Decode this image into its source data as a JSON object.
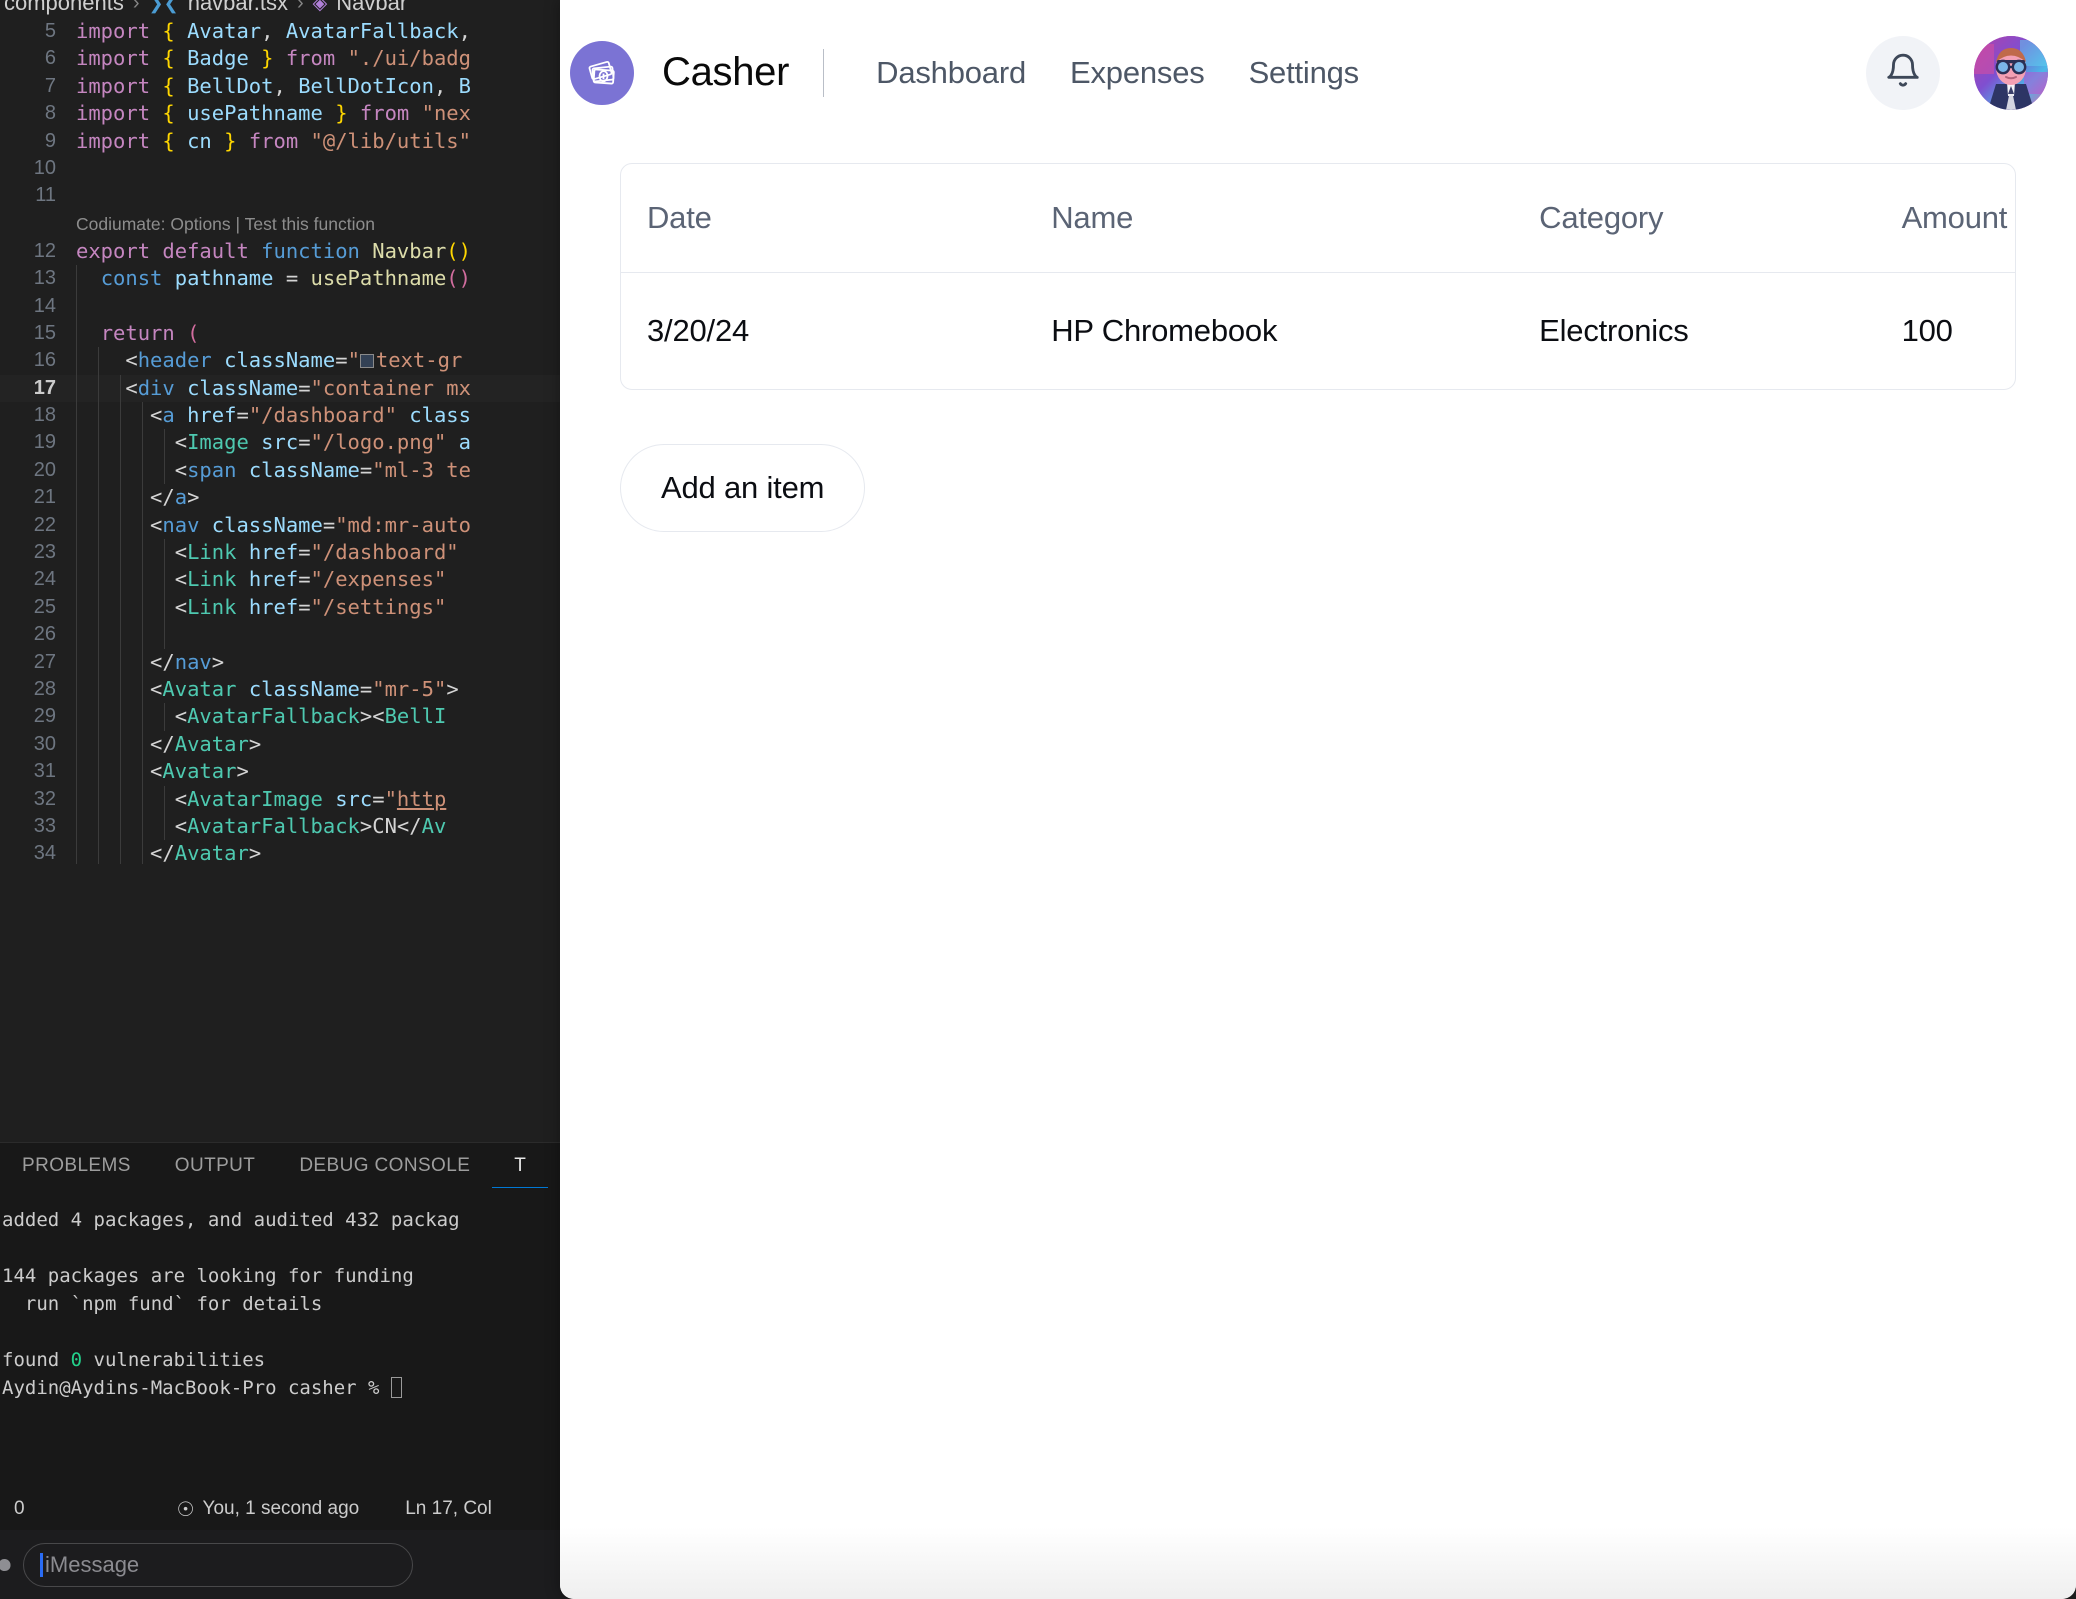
{
  "editor": {
    "breadcrumb": {
      "folder": "components",
      "file": "navbar.tsx",
      "symbol": "Navbar",
      "sep": "›"
    },
    "codiumate_hint": "Codiumate: Options | Test this function",
    "lines": [
      {
        "n": "5",
        "tokens": [
          [
            "t-kw",
            "import "
          ],
          [
            "t-br",
            "{ "
          ],
          [
            "t-var",
            "Avatar"
          ],
          [
            "t-plain",
            ", "
          ],
          [
            "t-var",
            "AvatarFallback"
          ],
          [
            "t-plain",
            ","
          ]
        ]
      },
      {
        "n": "6",
        "tokens": [
          [
            "t-kw",
            "import "
          ],
          [
            "t-br",
            "{ "
          ],
          [
            "t-var",
            "Badge"
          ],
          [
            "t-br",
            " } "
          ],
          [
            "t-kw",
            "from "
          ],
          [
            "t-str",
            "\"./ui/badg"
          ]
        ]
      },
      {
        "n": "7",
        "tokens": [
          [
            "t-kw",
            "import "
          ],
          [
            "t-br",
            "{ "
          ],
          [
            "t-var",
            "BellDot"
          ],
          [
            "t-plain",
            ", "
          ],
          [
            "t-var",
            "BellDotIcon"
          ],
          [
            "t-plain",
            ", "
          ],
          [
            "t-var",
            "B"
          ]
        ]
      },
      {
        "n": "8",
        "tokens": [
          [
            "t-kw",
            "import "
          ],
          [
            "t-br",
            "{ "
          ],
          [
            "t-var",
            "usePathname"
          ],
          [
            "t-br",
            " } "
          ],
          [
            "t-kw",
            "from "
          ],
          [
            "t-str",
            "\"nex"
          ]
        ]
      },
      {
        "n": "9",
        "tokens": [
          [
            "t-kw",
            "import "
          ],
          [
            "t-br",
            "{ "
          ],
          [
            "t-var",
            "cn"
          ],
          [
            "t-br",
            " } "
          ],
          [
            "t-kw",
            "from "
          ],
          [
            "t-str",
            "\"@/lib/utils\""
          ]
        ]
      },
      {
        "n": "10",
        "tokens": []
      },
      {
        "n": "11",
        "tokens": []
      },
      {
        "n": "12",
        "tokens": [
          [
            "t-kw",
            "export default "
          ],
          [
            "t-tag2",
            "function "
          ],
          [
            "t-fn",
            "Navbar"
          ],
          [
            "t-br",
            "()"
          ]
        ]
      },
      {
        "n": "13",
        "tokens": [
          [
            "t-plain",
            "  "
          ],
          [
            "t-tag2",
            "const "
          ],
          [
            "t-var",
            "pathname "
          ],
          [
            "t-plain",
            "= "
          ],
          [
            "t-fn",
            "usePathname"
          ],
          [
            "t-paren",
            "()"
          ]
        ]
      },
      {
        "n": "14",
        "tokens": []
      },
      {
        "n": "15",
        "tokens": [
          [
            "t-plain",
            "  "
          ],
          [
            "t-kw",
            "return "
          ],
          [
            "t-paren",
            "("
          ]
        ]
      },
      {
        "n": "16",
        "tokens": [
          [
            "t-plain",
            "    <"
          ],
          [
            "t-tag2",
            "header "
          ],
          [
            "t-attr",
            "className"
          ],
          [
            "t-plain",
            "="
          ],
          [
            "t-str",
            "\""
          ],
          [
            "SWATCH",
            ""
          ],
          [
            "t-str",
            "text-gr"
          ]
        ]
      },
      {
        "n": "17",
        "tokens": [
          [
            "t-plain",
            "    <"
          ],
          [
            "t-tag2",
            "div "
          ],
          [
            "t-attr",
            "className"
          ],
          [
            "t-plain",
            "="
          ],
          [
            "t-str",
            "\"container mx"
          ]
        ],
        "active": true
      },
      {
        "n": "18",
        "tokens": [
          [
            "t-plain",
            "      <"
          ],
          [
            "t-tag2",
            "a "
          ],
          [
            "t-attr",
            "href"
          ],
          [
            "t-plain",
            "="
          ],
          [
            "t-str",
            "\"/dashboard\" "
          ],
          [
            "t-attr",
            "class"
          ]
        ]
      },
      {
        "n": "19",
        "tokens": [
          [
            "t-plain",
            "        <"
          ],
          [
            "t-tag",
            "Image "
          ],
          [
            "t-attr",
            "src"
          ],
          [
            "t-plain",
            "="
          ],
          [
            "t-str",
            "\"/logo.png\" "
          ],
          [
            "t-attr",
            "a"
          ]
        ]
      },
      {
        "n": "20",
        "tokens": [
          [
            "t-plain",
            "        <"
          ],
          [
            "t-tag2",
            "span "
          ],
          [
            "t-attr",
            "className"
          ],
          [
            "t-plain",
            "="
          ],
          [
            "t-str",
            "\"ml-3 te"
          ]
        ]
      },
      {
        "n": "21",
        "tokens": [
          [
            "t-plain",
            "      </"
          ],
          [
            "t-tag2",
            "a"
          ],
          [
            "t-plain",
            ">"
          ]
        ]
      },
      {
        "n": "22",
        "tokens": [
          [
            "t-plain",
            "      <"
          ],
          [
            "t-tag2",
            "nav "
          ],
          [
            "t-attr",
            "className"
          ],
          [
            "t-plain",
            "="
          ],
          [
            "t-str",
            "\"md:mr-auto"
          ]
        ]
      },
      {
        "n": "23",
        "tokens": [
          [
            "t-plain",
            "        <"
          ],
          [
            "t-tag",
            "Link "
          ],
          [
            "t-attr",
            "href"
          ],
          [
            "t-plain",
            "="
          ],
          [
            "t-str",
            "\"/dashboard\""
          ]
        ]
      },
      {
        "n": "24",
        "tokens": [
          [
            "t-plain",
            "        <"
          ],
          [
            "t-tag",
            "Link "
          ],
          [
            "t-attr",
            "href"
          ],
          [
            "t-plain",
            "="
          ],
          [
            "t-str",
            "\"/expenses\""
          ]
        ]
      },
      {
        "n": "25",
        "tokens": [
          [
            "t-plain",
            "        <"
          ],
          [
            "t-tag",
            "Link "
          ],
          [
            "t-attr",
            "href"
          ],
          [
            "t-plain",
            "="
          ],
          [
            "t-str",
            "\"/settings\""
          ]
        ]
      },
      {
        "n": "26",
        "tokens": []
      },
      {
        "n": "27",
        "tokens": [
          [
            "t-plain",
            "      </"
          ],
          [
            "t-tag2",
            "nav"
          ],
          [
            "t-plain",
            ">"
          ]
        ]
      },
      {
        "n": "28",
        "tokens": [
          [
            "t-plain",
            "      <"
          ],
          [
            "t-tag",
            "Avatar "
          ],
          [
            "t-attr",
            "className"
          ],
          [
            "t-plain",
            "="
          ],
          [
            "t-str",
            "\"mr-5\""
          ],
          [
            "t-plain",
            ">"
          ]
        ]
      },
      {
        "n": "29",
        "tokens": [
          [
            "t-plain",
            "        <"
          ],
          [
            "t-tag",
            "AvatarFallback"
          ],
          [
            "t-plain",
            "><"
          ],
          [
            "t-tag",
            "BellI"
          ]
        ]
      },
      {
        "n": "30",
        "tokens": [
          [
            "t-plain",
            "      </"
          ],
          [
            "t-tag",
            "Avatar"
          ],
          [
            "t-plain",
            ">"
          ]
        ]
      },
      {
        "n": "31",
        "tokens": [
          [
            "t-plain",
            "      <"
          ],
          [
            "t-tag",
            "Avatar"
          ],
          [
            "t-plain",
            ">"
          ]
        ]
      },
      {
        "n": "32",
        "tokens": [
          [
            "t-plain",
            "        <"
          ],
          [
            "t-tag",
            "AvatarImage "
          ],
          [
            "t-attr",
            "src"
          ],
          [
            "t-plain",
            "="
          ],
          [
            "t-str",
            "\""
          ],
          [
            "LINK",
            "http"
          ]
        ]
      },
      {
        "n": "33",
        "tokens": [
          [
            "t-plain",
            "        <"
          ],
          [
            "t-tag",
            "AvatarFallback"
          ],
          [
            "t-plain",
            ">CN</"
          ],
          [
            "t-tag",
            "Av"
          ]
        ]
      },
      {
        "n": "34",
        "tokens": [
          [
            "t-plain",
            "      </"
          ],
          [
            "t-tag",
            "Avatar"
          ],
          [
            "t-plain",
            ">"
          ]
        ]
      }
    ],
    "panel_tabs": [
      {
        "label": "PROBLEMS",
        "active": false
      },
      {
        "label": "OUTPUT",
        "active": false
      },
      {
        "label": "DEBUG CONSOLE",
        "active": false
      },
      {
        "label": "T",
        "active": true
      }
    ],
    "terminal_lines": [
      "added 4 packages, and audited 432 packag",
      "",
      "144 packages are looking for funding",
      "  run `npm fund` for details",
      "",
      "found 0 vulnerabilities"
    ],
    "terminal_prompt": "Aydin@Aydins-MacBook-Pro casher % ",
    "statusbar": {
      "errors": "0",
      "git_author": "You, 1 second ago",
      "cursor_pos": "Ln 17, Col"
    }
  },
  "imessage": {
    "placeholder": "iMessage"
  },
  "app": {
    "brand": "Casher",
    "nav": [
      {
        "label": "Dashboard"
      },
      {
        "label": "Expenses"
      },
      {
        "label": "Settings"
      }
    ],
    "table": {
      "columns": [
        "Date",
        "Name",
        "Category",
        "Amount"
      ],
      "rows": [
        {
          "date": "3/20/24",
          "name": "HP Chromebook",
          "category": "Electronics",
          "amount": "100"
        }
      ]
    },
    "add_item_label": "Add an item",
    "colors": {
      "brand_purple": "#7b73d4",
      "nav_text": "#4d5766",
      "table_header_text": "#5b6475",
      "card_border": "#e6e9ef",
      "bell_bg": "#f1f3f7"
    }
  }
}
